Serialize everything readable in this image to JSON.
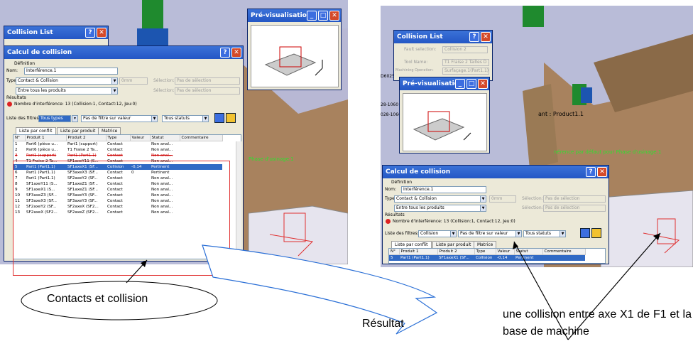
{
  "left": {
    "collision_list_title": "Collision List",
    "preview_title": "Pré-visualisation",
    "dialog_title": "Calcul de collision",
    "definition_label": "Définition",
    "name_label": "Nom:",
    "name_value": "Interférence.1",
    "type_label": "Type:",
    "type_value": "Contact & Collision",
    "scope_value": "Entre tous les produits",
    "dim_value": "0mm",
    "selection_label": "Sélection:",
    "selection1_value": "Pas de sélection",
    "selection2_value": "Pas de sélection",
    "results_label": "Résultats",
    "interference_count": "Nombre d'interférence: 13 (Collision:1, Contact:12, Jeu:0)",
    "filter_label": "Liste des filtres:",
    "filter_type": "Tous types",
    "filter_value": "Pas de filtre sur valeur",
    "filter_status": "Tous statuts",
    "tabs": [
      "Liste par conflit",
      "Liste par produit",
      "Matrice"
    ],
    "columns": [
      "N°",
      "Produit 1",
      "Produit 2",
      "Type",
      "Valeur",
      "Statut",
      "Commentaire"
    ],
    "rows": [
      [
        "1",
        "Part6 (pièce u...",
        "Part1 (support)",
        "Contact",
        "",
        "Non anal...",
        ""
      ],
      [
        "2",
        "Part6 (pièce u...",
        "T1 Fraise 2 Ta...",
        "Contact",
        "",
        "Non anal...",
        ""
      ],
      [
        "3",
        "Part1 (support)",
        "Part1 (Part1.1)",
        "Contact",
        "",
        "Non anal...",
        ""
      ],
      [
        "4",
        "T1 Fraise 2 Ta...",
        "SF1axeY11 (S...",
        "Contact",
        "",
        "Non anal...",
        ""
      ],
      [
        "5",
        "Part1 (Part1.1)",
        "SF1axeX1 (SF...",
        "Collision",
        "-0,14",
        "Pertinent",
        ""
      ],
      [
        "6",
        "Part1 (Part1.1)",
        "SF3axeX3 (SF...",
        "Contact",
        "0",
        "Pertinent",
        ""
      ],
      [
        "7",
        "Part1 (Part1.1)",
        "SF2axeY2 (SF...",
        "Contact",
        "",
        "Non anal...",
        ""
      ],
      [
        "8",
        "SF1axeY11 (S...",
        "SF1axeZ1 (SF...",
        "Contact",
        "",
        "Non anal...",
        ""
      ],
      [
        "9",
        "SF1axeX1 (S...",
        "SF1axeZ1 (SF...",
        "Contact",
        "",
        "Non anal...",
        ""
      ],
      [
        "10",
        "SF3axeZ3 (SF...",
        "SF3axeY3 (SF...",
        "Contact",
        "",
        "Non anal...",
        ""
      ],
      [
        "11",
        "SF3axeX3 (SF...",
        "SF3axeY3 (SF...",
        "Contact",
        "",
        "Non anal...",
        ""
      ],
      [
        "12",
        "SF2axeY2 (SF...",
        "SF2axeX (SF2...",
        "Contact",
        "",
        "Non anal...",
        ""
      ],
      [
        "13",
        "SF2axeX (SF2...",
        "SF2axeZ (SF2...",
        "Contact",
        "",
        "Non anal...",
        ""
      ]
    ],
    "scene_label": "Phase d'usinage.1"
  },
  "right": {
    "collision_list_title": "Collision List",
    "fault_selection_label": "Fault selection:",
    "fault_selection_value": "Collision 2",
    "tool_name_label": "Tool Name:",
    "tool_name_value": "T1 Fraise 2 Tailles D 2(",
    "machining_op_label": "Machining Operation:",
    "machining_op_value": "Surfaçage.1(Part1.1)",
    "preview_title": "Pré-visualisation",
    "dialog_title": "Calcul de collision",
    "definition_label": "Définition",
    "name_label": "Nom:",
    "name_value": "Interférence.1",
    "type_label": "Type:",
    "type_value": "Contact & Collision",
    "scope_value": "Entre tous les produits",
    "dim_value": "0mm",
    "selection_label": "Sélection:",
    "selection1_value": "Pas de sélection",
    "selection2_value": "Pas de sélection",
    "results_label": "Résultats",
    "interference_count": "Nombre d'interférence: 13 (Collision:1, Contact:12, Jeu:0)",
    "filter_label": "Liste des filtres:",
    "filter_type": "Collision",
    "filter_value": "Pas de filtre sur valeur",
    "filter_status": "Tous statuts",
    "tabs": [
      "Liste par conflit",
      "Liste par produit",
      "Matrice"
    ],
    "columns": [
      "N°",
      "Produit 1",
      "Produit 2",
      "Type",
      "Valeur",
      "Statut",
      "Commentaire"
    ],
    "rows": [
      [
        "5",
        "Part1 (Part1.1)",
        "SF1axeX1 (SF...",
        "Collision",
        "-0,14",
        "Pertinent",
        ""
      ]
    ],
    "scene_label_product": "ant : Product1.1",
    "scene_label_phase": "nérence par défaut pour Phase d'usinage.1",
    "side_numbers": [
      "D6025",
      "28-1060",
      "028-1060"
    ]
  },
  "captions": {
    "contacts": "Contacts et collision",
    "resultat": "Résultat",
    "explanation": "une collision entre axe X1 de F1 et la base de machine"
  },
  "colors": {
    "titlebar": "#2457c5",
    "scene_bg": "#b9bcd8",
    "annotation_red": "#e03030",
    "arrow_blue": "#2a6fd6"
  }
}
